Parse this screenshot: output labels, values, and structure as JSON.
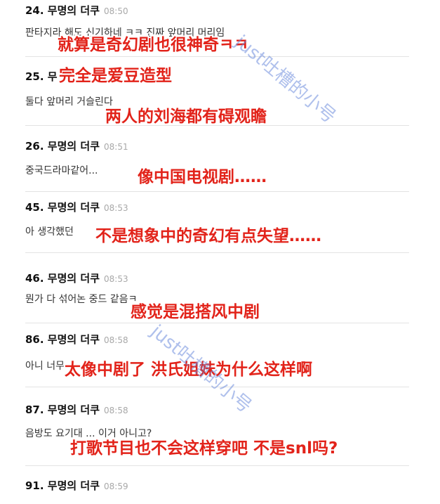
{
  "comments": [
    {
      "num": "24. 무명의 더쿠",
      "time": "08:50",
      "body": "판타지라 해도 신기하네 ㅋㅋ 진짜 앞머리 머리임"
    },
    {
      "num": "25. 무",
      "time": "",
      "body": "둘다 앞머리 거슬린다"
    },
    {
      "num": "26. 무명의 더쿠",
      "time": "08:51",
      "body": "중국드라마같어..."
    },
    {
      "num": "45. 무명의 더쿠",
      "time": "08:53",
      "body": "아 생각했던"
    },
    {
      "num": "46. 무명의 더쿠",
      "time": "08:53",
      "body": "뭔가 다 섞어논 중드 같음ㅋ"
    },
    {
      "num": "86. 무명의 더쿠",
      "time": "08:58",
      "body": "아니 너무"
    },
    {
      "num": "87. 무명의 더쿠",
      "time": "08:58",
      "body": "음방도 요기대 ... 이거 아니고?"
    },
    {
      "num": "91. 무명의 더쿠",
      "time": "08:59",
      "body": ""
    }
  ],
  "captions": [
    "就算是奇幻剧也很神奇ㅋㅋ",
    "完全是爱豆造型",
    "两人的刘海都有碍观瞻",
    "像中国电视剧……",
    "不是想象中的奇幻有点失望……",
    "感觉是混搭风中剧",
    "太像中剧了 洪氏姐妹为什么这样啊",
    "打歌节目也不会这样穿吧 不是snl吗?"
  ],
  "watermark": "just吐槽的小号"
}
